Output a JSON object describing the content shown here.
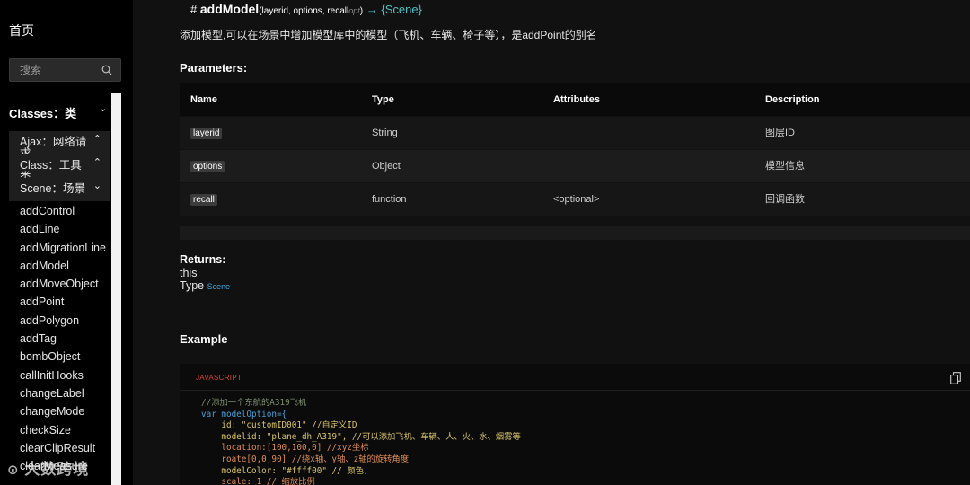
{
  "sidebar": {
    "home": "首页",
    "search_placeholder": "搜索",
    "classes_heading": "Classes：类",
    "groups": [
      {
        "label": "Ajax：网络请求"
      },
      {
        "label": "Class：工具类"
      },
      {
        "label": "Scene：场景"
      }
    ],
    "items": [
      "addControl",
      "addLine",
      "addMigrationLine",
      "addModel",
      "addMoveObject",
      "addPoint",
      "addPolygon",
      "addTag",
      "bombObject",
      "callInitHooks",
      "changeLabel",
      "changeMode",
      "checkSize",
      "clearClipResult",
      "clearMeasure"
    ]
  },
  "method": {
    "hash": "#",
    "name": "addModel",
    "params_text": "(layerid, options, recall",
    "optional_tag": "opt",
    "params_close": ")",
    "arrow": "→",
    "return_type": "{Scene}",
    "description": "添加模型,可以在场景中增加模型库中的模型（飞机、车辆、椅子等），是addPoint的别名"
  },
  "parameters": {
    "title": "Parameters:",
    "headers": [
      "Name",
      "Type",
      "Attributes",
      "Description"
    ],
    "rows": [
      {
        "name": "layerid",
        "type": "String",
        "attributes": "",
        "description": "图层ID"
      },
      {
        "name": "options",
        "type": "Object",
        "attributes": "",
        "description": "模型信息"
      },
      {
        "name": "recall",
        "type": "function",
        "attributes": "<optional>",
        "description": "回调函数"
      }
    ]
  },
  "returns": {
    "label": "Returns:",
    "value": "this",
    "type_label": "Type",
    "type_value": "Scene"
  },
  "example": {
    "title": "Example",
    "language": "JAVASCRIPT",
    "lines": [
      "//添加一个东航的A319飞机",
      "var modelOption={",
      "    id: \"customID001\" //自定义ID",
      "    modelid: \"plane_dh_A319\", //可以添加飞机、车辆、人、火、水、烟雾等",
      "    location:[100,100,0] //xyz坐标",
      "    roate[0,0,90] //绕x轴、y轴、z轴的旋转角度",
      "    modelColor: \"#ffff00\" // 颜色，",
      "    scale: 1 // 缩放比例"
    ]
  },
  "watermark": "大数跨境",
  "colors": {
    "background": "#111111",
    "sidebar": "#000000",
    "accent_link": "#3aa6e0",
    "return_type": "#4fc1c6",
    "lang_label": "#d8453a"
  }
}
